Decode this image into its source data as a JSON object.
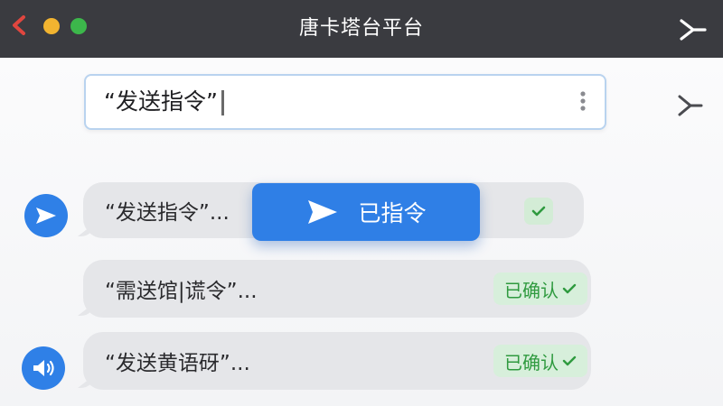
{
  "window": {
    "title": "唐卡塔台平台",
    "controls": [
      "back-chevron",
      "yellow-dot",
      "green-dot"
    ]
  },
  "colors": {
    "titlebar": "#3a3b40",
    "accent": "#2f7fe6",
    "confirm_bg": "#d7efdb",
    "confirm_text": "#2f9a3f",
    "bubble": "#e5e6e9",
    "traffic_red": "#e0463f",
    "traffic_yellow": "#f2b430",
    "traffic_green": "#3cb74b"
  },
  "input": {
    "value": "“发送指令”"
  },
  "toast": {
    "label": "已指令",
    "icon": "send-icon"
  },
  "messages": [
    {
      "text": "“发送指令”...",
      "status_icon": "check-icon",
      "avatar_icon": "send-icon"
    },
    {
      "text": "“需送馆|谎令”...",
      "status_label": "已确认",
      "status_icon": "check-icon"
    },
    {
      "text": "“发送黄语砑”...",
      "status_label": "已确认",
      "status_icon": "check-icon",
      "avatar_icon": "speaker-icon"
    }
  ]
}
